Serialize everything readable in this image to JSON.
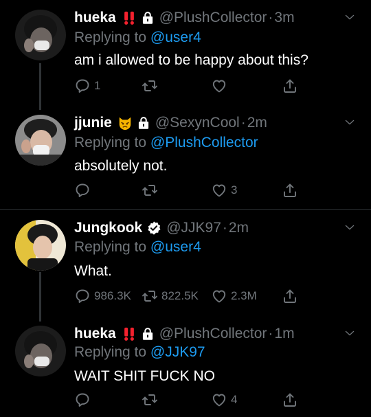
{
  "tweets": [
    {
      "name": "hueka",
      "badge": "‼️",
      "handle": "@PlushCollector",
      "time": "3m",
      "replying_prefix": "Replying to",
      "replying_to": "@user4",
      "text": "am i allowed to be happy about this?",
      "replies": "1",
      "retweets": "",
      "likes": ""
    },
    {
      "name": "jjunie",
      "badge": "😾",
      "handle": "@SexynCool",
      "time": "2m",
      "replying_prefix": "Replying to",
      "replying_to": "@PlushCollector",
      "text": "absolutely not.",
      "replies": "",
      "retweets": "",
      "likes": "3"
    },
    {
      "name": "Jungkook",
      "badge": "verified",
      "handle": "@JJK97",
      "time": "2m",
      "replying_prefix": "Replying to",
      "replying_to": "@user4",
      "text": "What.",
      "replies": "986.3K",
      "retweets": "822.5K",
      "likes": "2.3M"
    },
    {
      "name": "hueka",
      "badge": "‼️",
      "handle": "@PlushCollector",
      "time": "1m",
      "replying_prefix": "Replying to",
      "replying_to": "@JJK97",
      "text": "WAIT SHIT FUCK NO",
      "replies": "",
      "retweets": "",
      "likes": "4"
    }
  ],
  "separator": "·",
  "colors": {
    "background": "#000000",
    "text": "#ffffff",
    "muted": "#71767b",
    "link": "#1d9bf0",
    "line": "#2f3336",
    "badge_red": "#f4212e",
    "verified": "#ffffff"
  },
  "icons": [
    "reply-icon",
    "retweet-icon",
    "like-icon",
    "share-icon",
    "lock-icon",
    "verified-icon",
    "chevron-down-icon"
  ]
}
